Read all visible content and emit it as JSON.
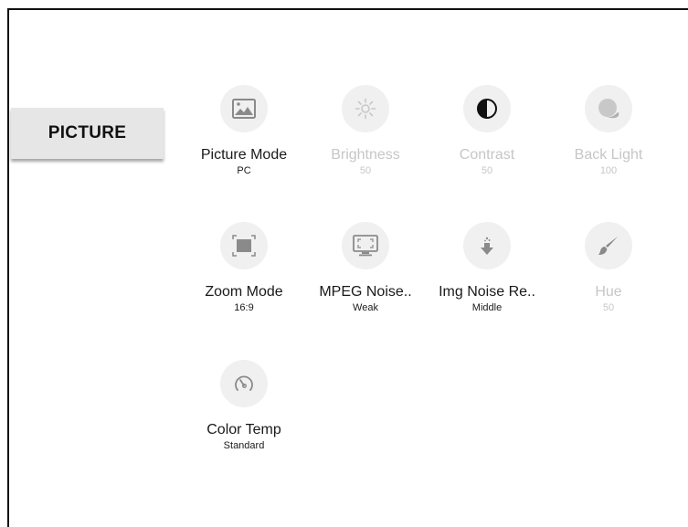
{
  "section_tab": {
    "label": "PICTURE"
  },
  "settings": [
    {
      "label": "Picture Mode",
      "value": "PC",
      "icon": "image-icon",
      "enabled": true
    },
    {
      "label": "Brightness",
      "value": "50",
      "icon": "sun-icon",
      "enabled": false
    },
    {
      "label": "Contrast",
      "value": "50",
      "icon": "contrast-icon",
      "enabled": false
    },
    {
      "label": "Back Light",
      "value": "100",
      "icon": "backlight-icon",
      "enabled": false
    },
    {
      "label": "Zoom Mode",
      "value": "16:9",
      "icon": "zoom-icon",
      "enabled": true
    },
    {
      "label": "MPEG Noise..",
      "value": "Weak",
      "icon": "monitor-noise-icon",
      "enabled": true
    },
    {
      "label": "Img Noise Re..",
      "value": "Middle",
      "icon": "noise-reduction-icon",
      "enabled": true
    },
    {
      "label": "Hue",
      "value": "50",
      "icon": "brush-icon",
      "enabled": false
    },
    {
      "label": "Color Temp",
      "value": "Standard",
      "icon": "gauge-icon",
      "enabled": true
    }
  ],
  "colors": {
    "icon_active": "#8a8a8a",
    "icon_inactive": "#c8c8c8",
    "circle_bg": "#f0f0f0",
    "tab_bg": "#e6e6e6"
  }
}
